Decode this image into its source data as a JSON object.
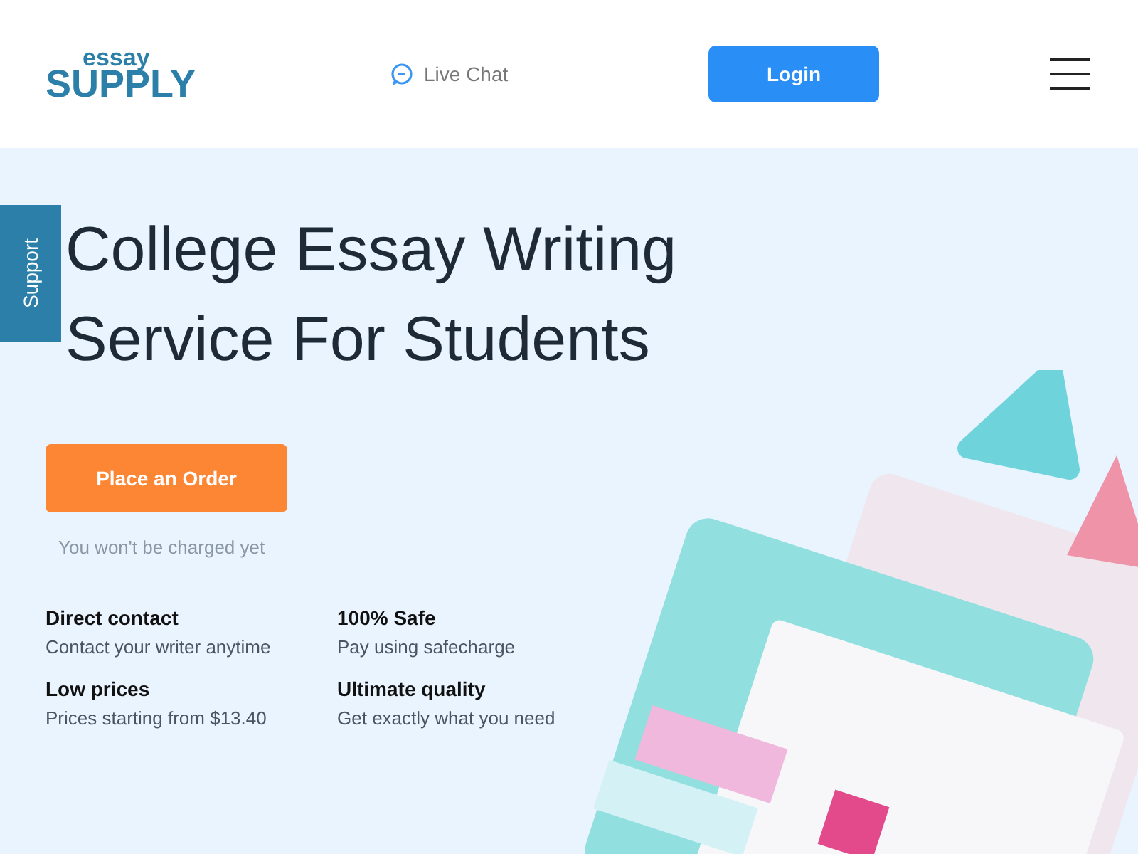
{
  "header": {
    "logo_top": "essay",
    "logo_bottom": "SUPPLY",
    "live_chat": "Live Chat",
    "login": "Login"
  },
  "support_tab": "Support",
  "hero": {
    "title_lines": [
      "College Essay Writing",
      "Service For Students"
    ],
    "order_button": "Place an Order",
    "note": "You won't be charged yet",
    "features": [
      {
        "title": "Direct contact",
        "text": "Contact your writer anytime"
      },
      {
        "title": "100% Safe",
        "text": "Pay using safecharge"
      },
      {
        "title": "Low prices",
        "text": "Prices starting from $13.40"
      },
      {
        "title": "Ultimate quality",
        "text": "Get exactly what you need"
      }
    ]
  }
}
